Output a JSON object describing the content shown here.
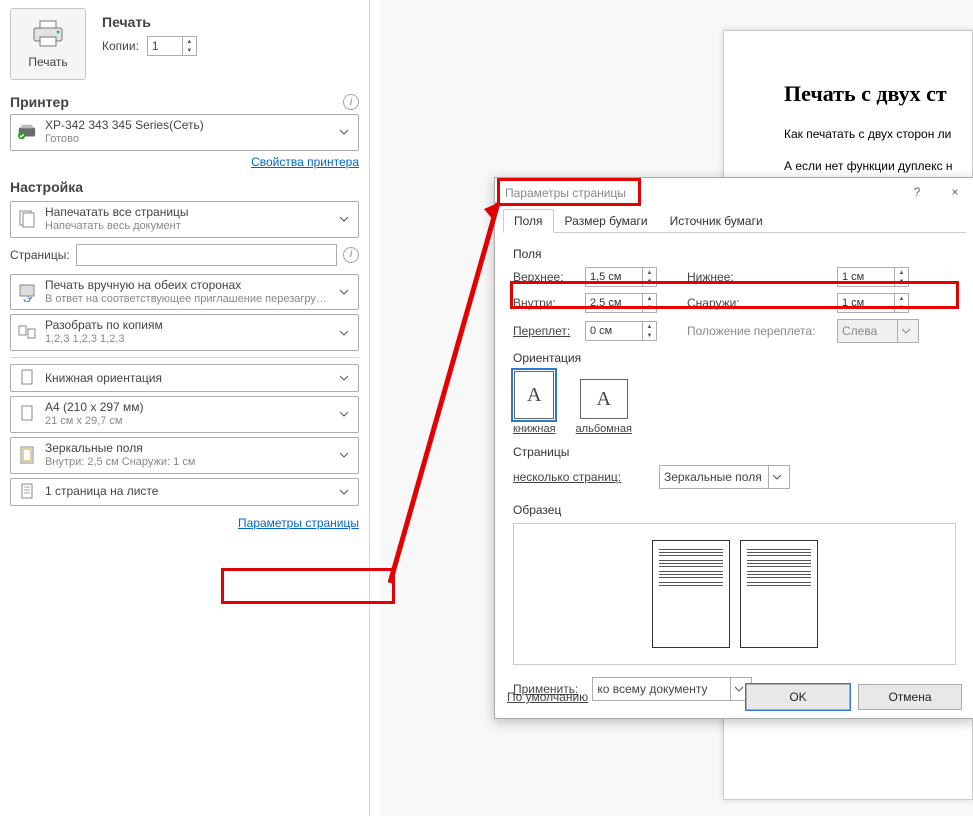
{
  "left": {
    "print_btn_label": "Печать",
    "print_heading": "Печать",
    "copies_label": "Копии:",
    "copies_value": "1",
    "printer_heading": "Принтер",
    "printer_name": "XP-342 343 345 Series(Сеть)",
    "printer_status": "Готово",
    "printer_props_link": "Свойства принтера",
    "settings_heading": "Настройка",
    "settings_all_pages": "Напечатать все страницы",
    "settings_all_pages_sub": "Напечатать весь документ",
    "pages_label": "Страницы:",
    "duplex_title": "Печать вручную на обеих сторонах",
    "duplex_sub": "В ответ на соответствующее приглашение перезагру…",
    "collate_title": "Разобрать по копиям",
    "collate_sub": "1,2,3    1,2,3    1,2,3",
    "orient_title": "Книжная ориентация",
    "paper_title": "A4 (210 x 297 мм)",
    "paper_sub": "21 см x 29,7 см",
    "mirror_title": "Зеркальные поля",
    "mirror_sub": "Внутри:  2,5 см    Снаружи:  1 см",
    "perpage_title": "1 страница на листе",
    "page_setup_link": "Параметры страницы"
  },
  "preview": {
    "title": "Печать с двух ст",
    "p1": "Как печатать с двух сторон ли",
    "p2": "А если нет функции дуплекс н"
  },
  "dialog": {
    "title": "Параметры страницы",
    "help": "?",
    "close": "×",
    "tabs": {
      "margins": "Поля",
      "paper": "Размер бумаги",
      "source": "Источник бумаги"
    },
    "margins": {
      "group": "Поля",
      "top_lbl": "Верхнее:",
      "top_val": "1,5 см",
      "bottom_lbl": "Нижнее:",
      "bottom_val": "1 см",
      "inside_lbl": "Внутри:",
      "inside_val": "2,5 см",
      "outside_lbl": "Снаружи:",
      "outside_val": "1 см",
      "gutter_lbl": "Переплет:",
      "gutter_val": "0 см",
      "gutter_pos_lbl": "Положение переплета:",
      "gutter_pos_val": "Слева"
    },
    "orientation": {
      "group": "Ориентация",
      "portrait": "книжная",
      "landscape": "альбомная",
      "glyph": "A"
    },
    "pages": {
      "group": "Страницы",
      "multi_lbl": "несколько страниц:",
      "multi_val": "Зеркальные поля"
    },
    "sample": {
      "group": "Образец"
    },
    "apply": {
      "lbl": "Применить:",
      "val": "ко всему документу"
    },
    "footer": {
      "default": "По умолчанию",
      "ok": "OK",
      "cancel": "Отмена"
    }
  }
}
